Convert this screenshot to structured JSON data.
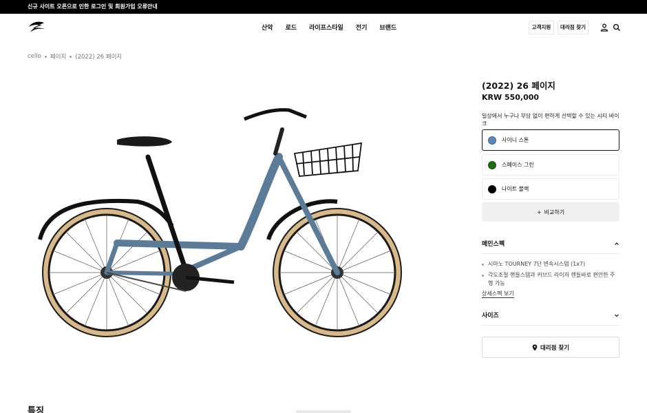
{
  "announcement": "신규 사이트 오픈으로 인한 로그인 및 회원가입 오류안내",
  "header": {
    "logo_icon": "cello-swoosh-logo",
    "nav": [
      "산악",
      "로드",
      "라이프스타일",
      "전기",
      "브랜드"
    ],
    "support_label": "고객지원",
    "dealer_label": "대리점 찾기",
    "icons": [
      "user-icon",
      "search-icon"
    ]
  },
  "breadcrumb": [
    "cello",
    "페이지",
    "(2022) 26 페이지"
  ],
  "product": {
    "title": "(2022) 26 페이지",
    "price": "KRW 550,000",
    "description": "일상에서 누구나 부담 없이 편하게 선택할 수 있는 시티 바이크",
    "frame_color": "#5b7c99",
    "tire_color": "#d9b98a"
  },
  "colors": [
    {
      "label": "사이니 스톤",
      "hex": "#5b8ab5",
      "selected": true
    },
    {
      "label": "스페이스 그린",
      "hex": "#1f6b1a",
      "selected": false
    },
    {
      "label": "나이트 블랙",
      "hex": "#000000",
      "selected": false
    }
  ],
  "compare_label": "비교하기",
  "main_spec": {
    "heading": "메인스펙",
    "items": [
      "시마노 TOURNEY 7단 변속시스템 (1x7)",
      "각도조절 핸들스템과 커브드 라이저 핸들바로 편안한 주행 가능"
    ],
    "more_label": "상세스펙 보기"
  },
  "size": {
    "heading": "사이즈"
  },
  "find_dealer_label": "대리점 찾기",
  "bottom_heading": "특징"
}
